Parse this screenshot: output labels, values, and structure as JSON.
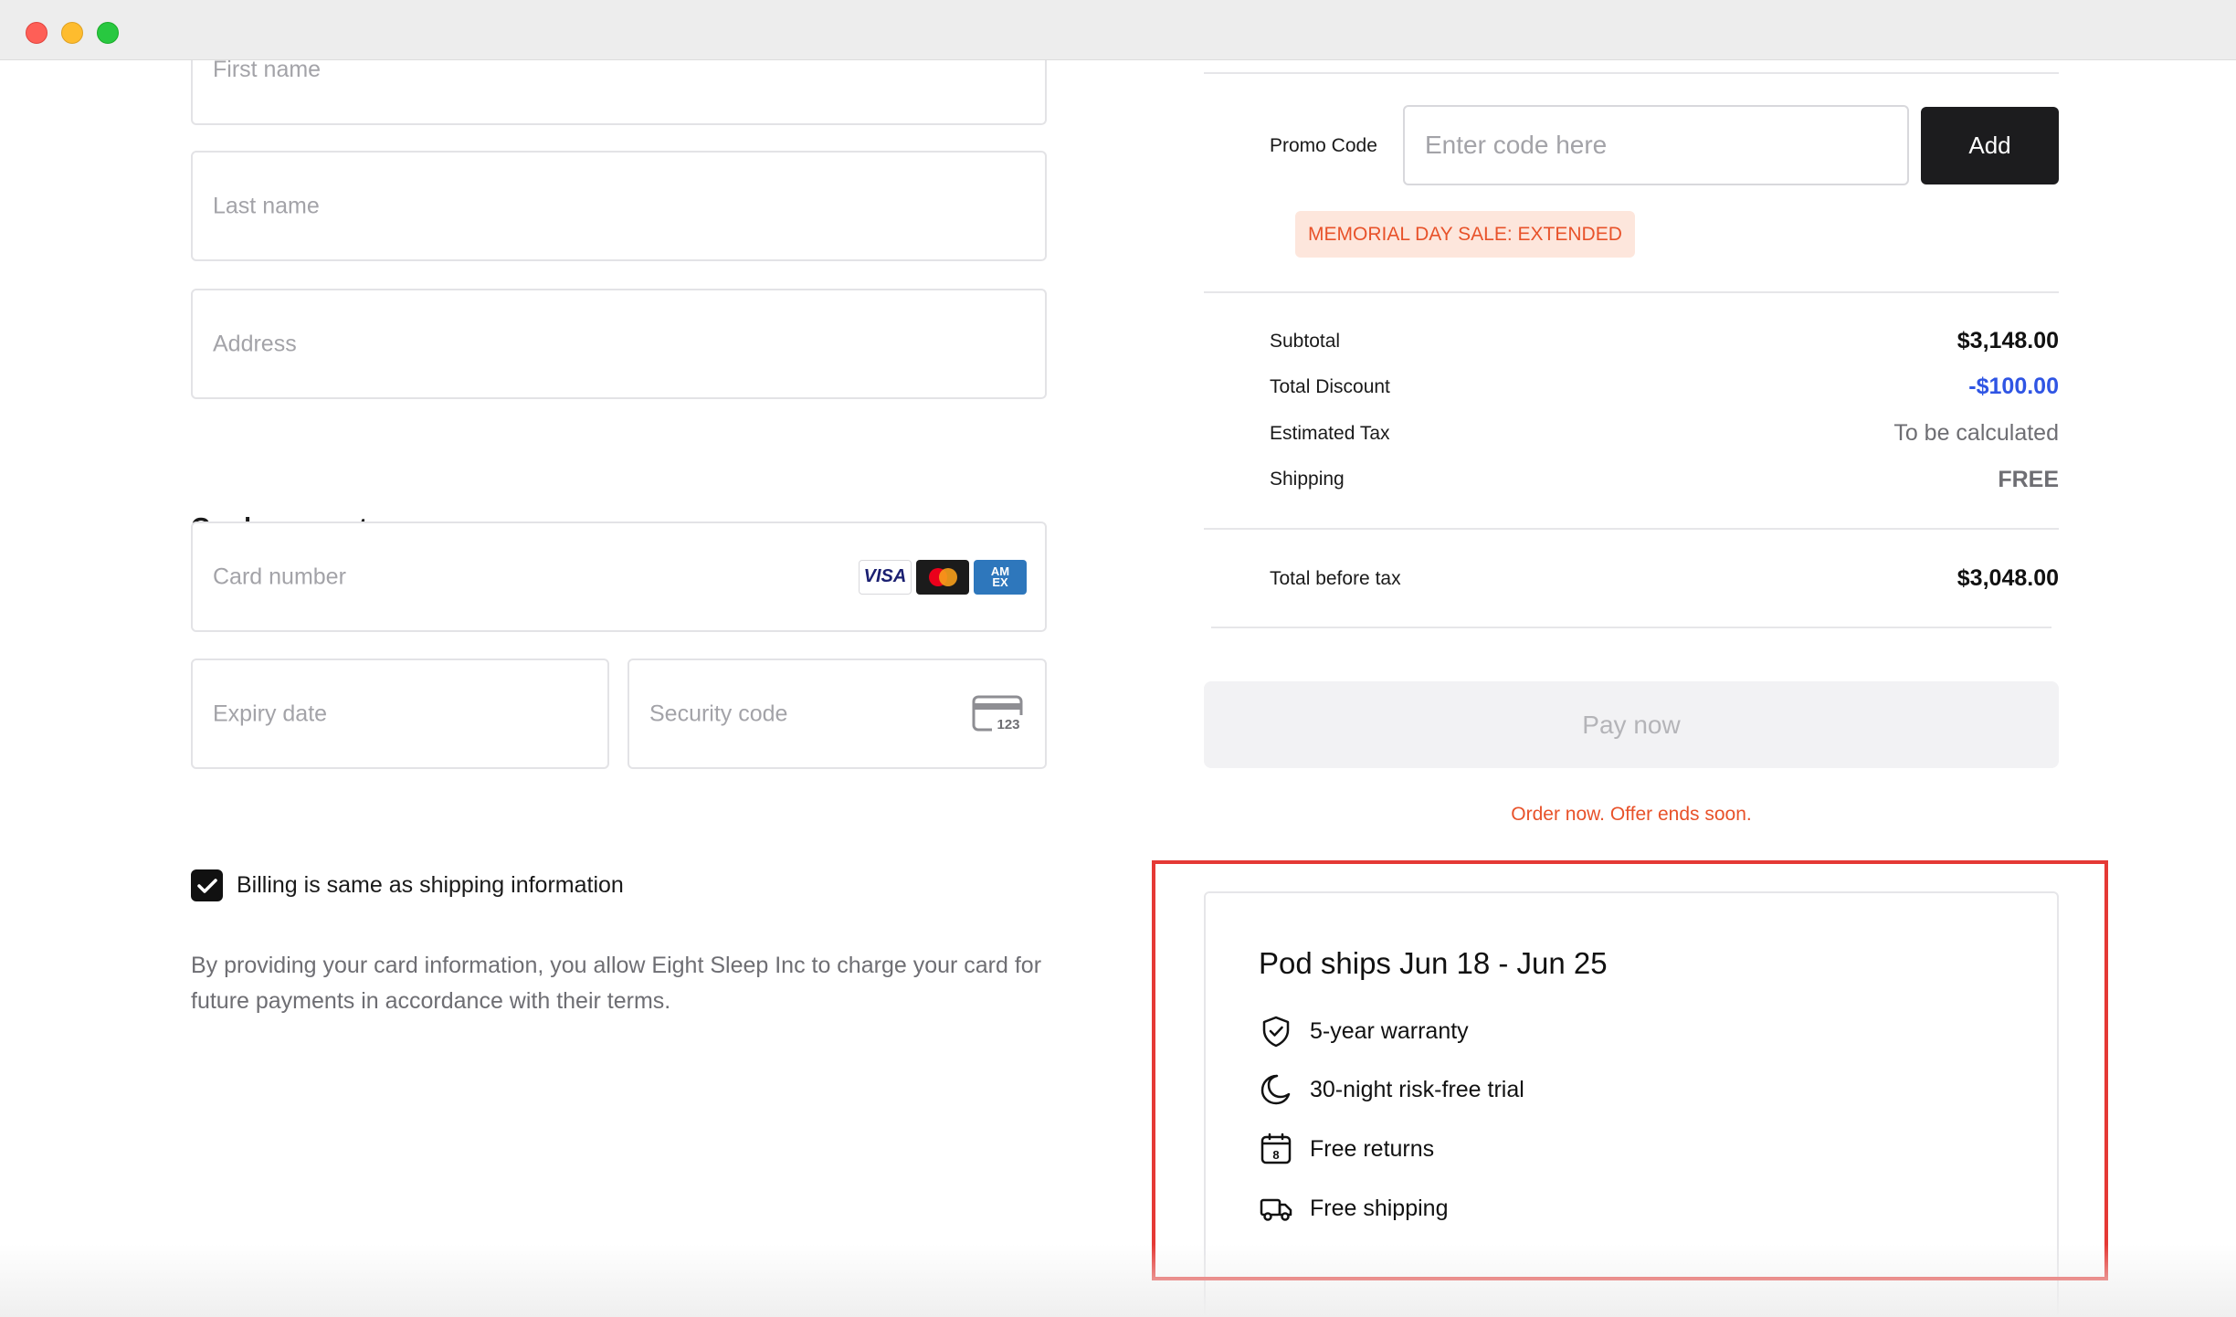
{
  "window": {
    "controls": [
      "close",
      "minimize",
      "maximize"
    ]
  },
  "form": {
    "first_name_placeholder": "First name",
    "last_name_placeholder": "Last name",
    "address_placeholder": "Address",
    "card_payment_title": "Card payment",
    "card_number_placeholder": "Card number",
    "card_brands": {
      "visa": "VISA",
      "mastercard": "",
      "amex": "AM EX"
    },
    "expiry_placeholder": "Expiry date",
    "security_code_placeholder": "Security code",
    "cvc_icon_text": "123",
    "billing_same_label": "Billing is same as shipping information",
    "billing_same_checked": true,
    "disclaimer": "By providing your card information, you allow Eight Sleep Inc to charge your card for future payments in accordance with their terms."
  },
  "summary": {
    "promo_label": "Promo Code",
    "promo_placeholder": "Enter code here",
    "promo_value": "",
    "add_button": "Add",
    "sale_badge": "MEMORIAL DAY SALE: EXTENDED",
    "rows": {
      "subtotal_label": "Subtotal",
      "subtotal_value": "$3,148.00",
      "discount_label": "Total Discount",
      "discount_value": "-$100.00",
      "tax_label": "Estimated Tax",
      "tax_value": "To be calculated",
      "shipping_label": "Shipping",
      "shipping_value": "FREE"
    },
    "total_label": "Total before tax",
    "total_value": "$3,048.00",
    "pay_button": "Pay now",
    "offer_text": "Order now. Offer ends soon."
  },
  "shipping_card": {
    "title": "Pod ships Jun 18 - Jun 25",
    "perks": [
      {
        "icon": "shield-check-icon",
        "label": "5-year warranty"
      },
      {
        "icon": "moon-icon",
        "label": "30-night risk-free trial"
      },
      {
        "icon": "calendar-icon",
        "label": "Free returns",
        "icon_text": "8"
      },
      {
        "icon": "truck-icon",
        "label": "Free shipping"
      }
    ]
  },
  "colors": {
    "accent_orange": "#e8522a",
    "discount_blue": "#2f55e4",
    "highlight_red": "#e53935",
    "button_dark": "#1c1c1e"
  }
}
